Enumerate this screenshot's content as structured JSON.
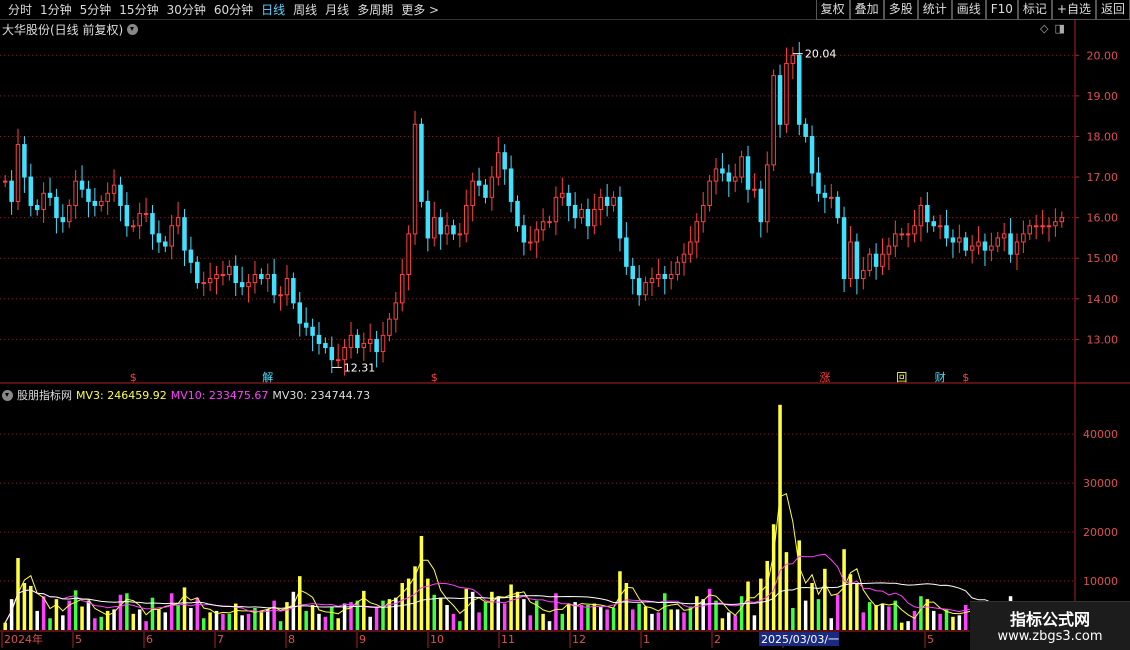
{
  "toolbar": {
    "left_items": [
      "分时",
      "1分钟",
      "5分钟",
      "15分钟",
      "30分钟",
      "60分钟",
      "日线",
      "周线",
      "月线",
      "多周期",
      "更多 >"
    ],
    "active_index": 6,
    "right_items": [
      "复权",
      "叠加",
      "多股",
      "统计",
      "画线",
      "F10",
      "标记",
      "+自选",
      "返回"
    ]
  },
  "main_chart": {
    "title": "大华股份(日线 前复权)",
    "price_labels": [
      "20.00",
      "19.00",
      "18.00",
      "17.00",
      "16.00",
      "15.00",
      "14.00",
      "13.00"
    ],
    "high_label": "20.04",
    "low_label": "12.31",
    "markers": [
      {
        "text": "$",
        "color": "#ff4040",
        "idx": 20
      },
      {
        "text": "解",
        "color": "#40e0ff",
        "idx": 41
      },
      {
        "text": "$",
        "color": "#ff4040",
        "idx": 67
      },
      {
        "text": "涨",
        "color": "#ff4040",
        "idx": 128
      },
      {
        "text": "回",
        "color": "#ffff40",
        "idx": 140
      },
      {
        "text": "财",
        "color": "#40e0ff",
        "idx": 146
      },
      {
        "text": "$",
        "color": "#ff4040",
        "idx": 150
      }
    ]
  },
  "volume_panel": {
    "title": "股朋指标网",
    "mv3_label": "MV3: 246459.92",
    "mv10_label": "MV10: 233475.67",
    "mv30_label": "MV30: 234744.73",
    "axis_labels": [
      "40000",
      "30000",
      "20000",
      "10000"
    ]
  },
  "date_axis": {
    "labels": [
      "2024年",
      "5",
      "6",
      "7",
      "8",
      "9",
      "10",
      "11",
      "12",
      "1",
      "2",
      "3",
      "4",
      "5",
      "6"
    ],
    "cursor_label": "2025/03/03/一"
  },
  "watermark": {
    "line1": "指标公式网",
    "line2": "www.zbgs3.com"
  },
  "colors": {
    "up": "#ff4040",
    "down": "#40e0ff",
    "mv3": "#ffff40",
    "mv10": "#ff40ff",
    "mv30": "#ffffff",
    "grid": "#8b1a1a"
  },
  "chart_data": {
    "type": "candlestick",
    "series_close": [
      16.9,
      16.4,
      17.8,
      17.0,
      16.3,
      16.2,
      16.6,
      16.5,
      16.0,
      15.9,
      16.3,
      16.9,
      16.7,
      16.4,
      16.3,
      16.4,
      16.6,
      16.8,
      16.3,
      15.8,
      15.8,
      16.1,
      16.1,
      15.6,
      15.4,
      15.3,
      15.8,
      16.0,
      15.2,
      14.9,
      14.4,
      14.4,
      14.5,
      14.6,
      14.6,
      14.8,
      14.4,
      14.3,
      14.4,
      14.6,
      14.5,
      14.6,
      14.1,
      14.1,
      14.5,
      13.9,
      13.4,
      13.3,
      13.1,
      12.9,
      12.8,
      12.5,
      12.5,
      12.8,
      13.1,
      12.8,
      12.9,
      13.0,
      12.7,
      13.1,
      13.5,
      13.9,
      14.6,
      15.6,
      18.3,
      16.4,
      15.5,
      16.0,
      15.6,
      15.8,
      15.6,
      15.6,
      16.3,
      16.9,
      16.8,
      16.5,
      17.0,
      17.6,
      17.2,
      16.4,
      15.8,
      15.4,
      15.4,
      15.7,
      15.9,
      15.9,
      16.5,
      16.6,
      16.3,
      16.0,
      16.2,
      15.8,
      16.2,
      16.5,
      16.3,
      16.5,
      15.5,
      14.8,
      14.5,
      14.1,
      14.4,
      14.5,
      14.6,
      14.5,
      14.6,
      14.9,
      15.1,
      15.4,
      15.9,
      16.3,
      16.9,
      17.2,
      17.1,
      16.9,
      17.0,
      17.5,
      16.7,
      16.7,
      15.9,
      17.3,
      19.5,
      18.3,
      19.8,
      20.0,
      18.3,
      18.0,
      17.1,
      16.6,
      16.5,
      16.5,
      16.0,
      14.5,
      15.4,
      14.5,
      14.7,
      15.1,
      14.8,
      15.1,
      15.3,
      15.6,
      15.6,
      15.6,
      15.8,
      16.3,
      15.9,
      15.8,
      15.8,
      15.5,
      15.4,
      15.5,
      15.2,
      15.3,
      15.4,
      15.2,
      15.3,
      15.5,
      15.6,
      15.1,
      15.4,
      15.6,
      15.8,
      15.8,
      15.8,
      15.8,
      15.9,
      16.0
    ],
    "ylim": [
      12.0,
      20.5
    ],
    "volume_ylim": [
      0,
      48000
    ]
  }
}
